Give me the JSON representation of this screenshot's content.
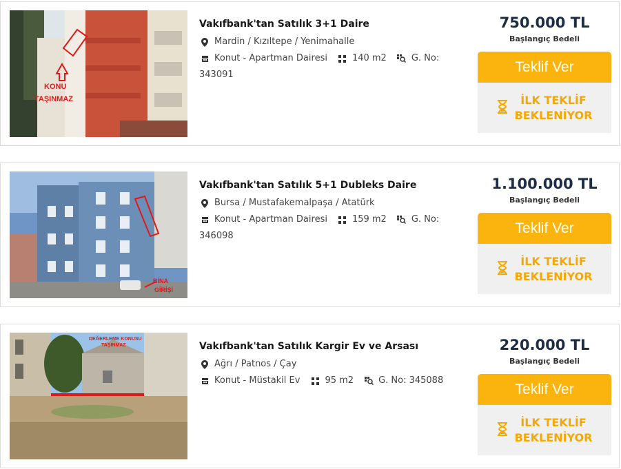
{
  "listings": [
    {
      "title": "Vakıfbank'tan Satılık 3+1 Daire",
      "location": "Mardin / Kızıltepe / Yenimahalle",
      "type": "Konut - Apartman Dairesi",
      "area": "140 m2",
      "gno": "G. No:",
      "gno_value": "343091",
      "price": "750.000 TL",
      "price_label": "Başlangıç Bedeli",
      "offer_button": "Teklif Ver",
      "status_line1": "İLK TEKLİF",
      "status_line2": "BEKLENİYOR",
      "photo_text1": "KONU",
      "photo_text2": "TAŞINMAZ"
    },
    {
      "title": "Vakıfbank'tan Satılık 5+1 Dubleks Daire",
      "location": "Bursa / Mustafakemalpaşa / Atatürk",
      "type": "Konut - Apartman Dairesi",
      "area": "159 m2",
      "gno": "G. No:",
      "gno_value": "346098",
      "price": "1.100.000 TL",
      "price_label": "Başlangıç Bedeli",
      "offer_button": "Teklif Ver",
      "status_line1": "İLK TEKLİF",
      "status_line2": "BEKLENİYOR",
      "photo_text1": "BİNA",
      "photo_text2": "GİRİŞİ"
    },
    {
      "title": "Vakıfbank'tan Satılık Kargir Ev ve Arsası",
      "location": "Ağrı / Patnos / Çay",
      "type": "Konut - Müstakil Ev",
      "area": "95 m2",
      "gno": "G. No: 345088",
      "gno_value": "",
      "price": "220.000 TL",
      "price_label": "Başlangıç Bedeli",
      "offer_button": "Teklif Ver",
      "status_line1": "İLK TEKLİF",
      "status_line2": "BEKLENİYOR",
      "photo_text1": "DEĞERLEME KONUSU",
      "photo_text2": "TAŞINMAZ"
    }
  ],
  "icons": {
    "location": "map-pin-icon",
    "type": "building-icon",
    "area": "area-dots-icon",
    "gno": "id-search-icon",
    "status": "hourglass-icon"
  },
  "colors": {
    "accent": "#fbb40e",
    "status_text": "#f7a800",
    "price": "#1d2d44"
  }
}
